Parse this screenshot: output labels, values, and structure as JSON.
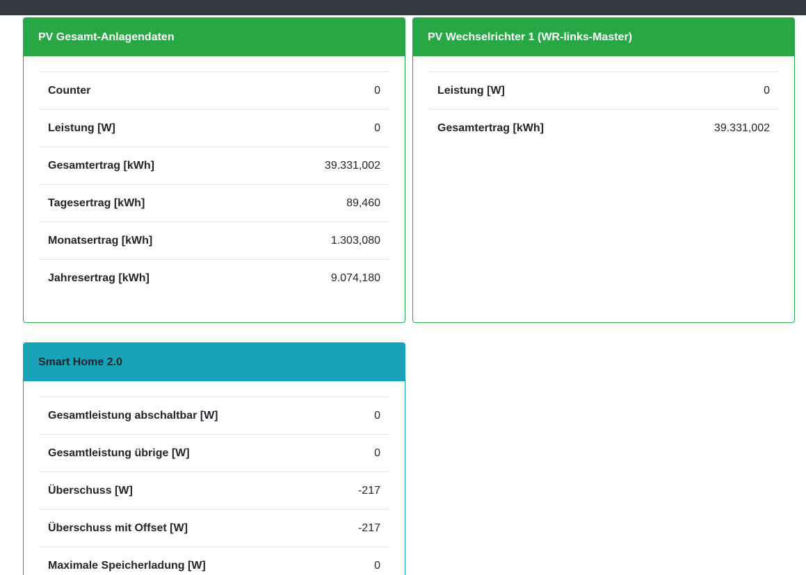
{
  "cards": {
    "pv_gesamt": {
      "title": "PV Gesamt-Anlagendaten",
      "rows": [
        {
          "label": "Counter",
          "value": "0"
        },
        {
          "label": "Leistung [W]",
          "value": "0"
        },
        {
          "label": "Gesamtertrag [kWh]",
          "value": "39.331,002"
        },
        {
          "label": "Tagesertrag [kWh]",
          "value": "89,460"
        },
        {
          "label": "Monatsertrag [kWh]",
          "value": "1.303,080"
        },
        {
          "label": "Jahresertrag [kWh]",
          "value": "9.074,180"
        }
      ]
    },
    "wr1": {
      "title": "PV Wechselrichter 1 (WR-links-Master)",
      "rows": [
        {
          "label": "Leistung [W]",
          "value": "0"
        },
        {
          "label": "Gesamtertrag [kWh]",
          "value": "39.331,002"
        }
      ]
    },
    "smarthome": {
      "title": "Smart Home 2.0",
      "rows": [
        {
          "label": "Gesamtleistung abschaltbar [W]",
          "value": "0"
        },
        {
          "label": "Gesamtleistung übrige [W]",
          "value": "0"
        },
        {
          "label": "Überschuss [W]",
          "value": "-217"
        },
        {
          "label": "Überschuss mit Offset [W]",
          "value": "-217"
        },
        {
          "label": "Maximale Speicherladung [W]",
          "value": "0"
        }
      ]
    }
  },
  "colors": {
    "topbar": "#343a40",
    "success": "#28a745",
    "info": "#17a2b8",
    "row_border": "#dee2e6"
  }
}
